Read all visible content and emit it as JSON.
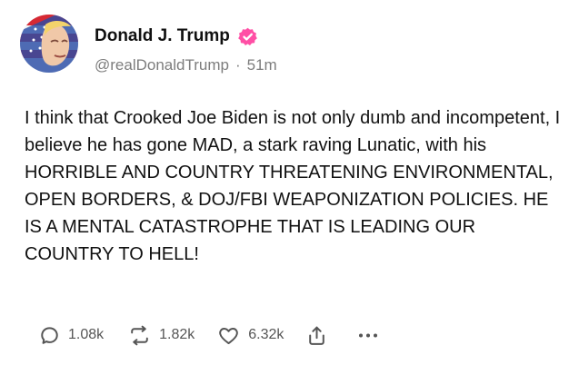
{
  "post": {
    "author": {
      "display_name": "Donald J. Trump",
      "handle": "@realDonaldTrump",
      "separator": "·",
      "timestamp": "51m",
      "verified": true,
      "verified_color": "#ff4fa5"
    },
    "text": "I think that Crooked Joe Biden is not only dumb and incompetent, I believe he has gone MAD, a stark raving Lunatic, with his HORRIBLE AND COUNTRY THREATENING ENVIRONMENTAL, OPEN BORDERS, & DOJ/FBI WEAPONIZATION POLICIES. HE IS A MENTAL CATASTROPHE THAT IS LEADING OUR COUNTRY TO HELL!",
    "actions": {
      "replies": "1.08k",
      "reposts": "1.82k",
      "likes": "6.32k"
    },
    "icons": {
      "reply": "reply-icon",
      "repost": "repost-icon",
      "like": "heart-icon",
      "share": "share-icon",
      "more": "more-icon",
      "verified": "verified-badge-icon",
      "avatar": "avatar"
    }
  }
}
